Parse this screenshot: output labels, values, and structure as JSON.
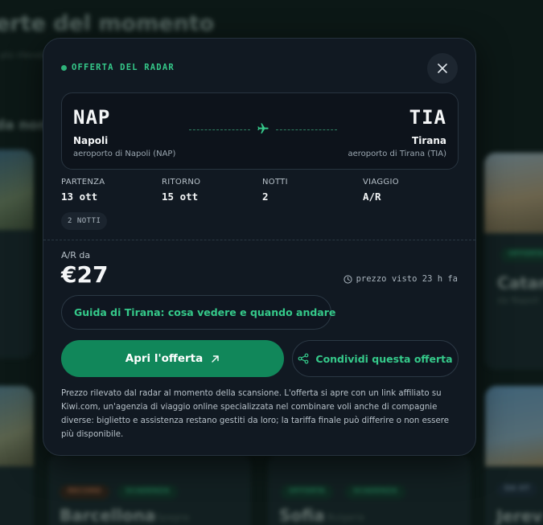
{
  "background": {
    "title": "erte del momento",
    "subtitle": "più rilevate",
    "section": "da non",
    "cards": [
      {
        "city": "Catani",
        "country": "da Napoli",
        "tags": [
          "OFFERTA"
        ]
      },
      {
        "city": "Barcellona",
        "country": "Spagna",
        "tags": [
          "RECORD",
          "SCADENZA"
        ]
      },
      {
        "city": "Sofia",
        "country": "Bulgaria",
        "tags": [
          "OFFERTA",
          "SCADENZA"
        ]
      },
      {
        "city": "Jerev",
        "country": "",
        "tags": [
          "DA OT"
        ]
      }
    ]
  },
  "modal": {
    "badge": "OFFERTA DEL RADAR",
    "close_icon": "close-icon",
    "route": {
      "origin_code": "NAP",
      "origin_city": "Napoli",
      "origin_airport": "aeroporto di Napoli (NAP)",
      "dest_code": "TIA",
      "dest_city": "Tirana",
      "dest_airport": "aeroporto di Tirana (TIA)",
      "plane_icon": "plane-icon"
    },
    "stats": [
      {
        "label": "PARTENZA",
        "value": "13 ott"
      },
      {
        "label": "RITORNO",
        "value": "15 ott"
      },
      {
        "label": "NOTTI",
        "value": "2"
      },
      {
        "label": "VIAGGIO",
        "value": "A/R"
      }
    ],
    "nights_chip": "2 NOTTI",
    "price_label": "A/R da",
    "price": "€27",
    "seen": "prezzo visto 23 h fa",
    "guide_button": "Guida di Tirana: cosa vedere e quando andare",
    "open_button": "Apri l'offerta",
    "share_button": "Condividi questa offerta",
    "disclaimer": "Prezzo rilevato dal radar al momento della scansione. L'offerta si apre con un link affiliato su Kiwi.com, un'agenzia di viaggio online specializzata nel combinare voli anche di compagnie diverse: biglietto e assistenza restano gestiti da loro; la tariffa finale può differire o non essere più disponibile.",
    "colors": {
      "accent": "#35c98a",
      "primary_button": "#11875a",
      "modal_bg": "#111922"
    }
  }
}
